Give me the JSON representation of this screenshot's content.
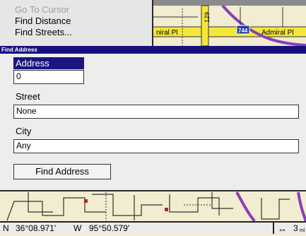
{
  "menu": {
    "items": [
      {
        "label": "Go To Cursor",
        "enabled": false
      },
      {
        "label": "Find Distance",
        "enabled": true
      },
      {
        "label": "Find Streets...",
        "enabled": true
      }
    ]
  },
  "map": {
    "street_label_left": "niral Pl",
    "street_label_right": "Admiral Pl",
    "highway_shield": "744",
    "vertical_label": "129"
  },
  "dialog": {
    "title": "Find Address",
    "address": {
      "label": "Address",
      "value": "0"
    },
    "street": {
      "label": "Street",
      "value": "None"
    },
    "city": {
      "label": "City",
      "value": "Any"
    },
    "find_button": "Find Address"
  },
  "status": {
    "lat_hemi": "N",
    "lat": "36°08.971'",
    "lon_hemi": "W",
    "lon": "95°50.579'",
    "range_icon": "double-arrow-icon",
    "range_value": "3",
    "range_unit": "mi"
  },
  "colors": {
    "dialog_title_bg": "#16117e",
    "selected_label_bg": "#1a1580",
    "map_bg": "#f2ecd0",
    "road_yellow": "#f4e63a",
    "road_purple": "#8a3fb5"
  }
}
